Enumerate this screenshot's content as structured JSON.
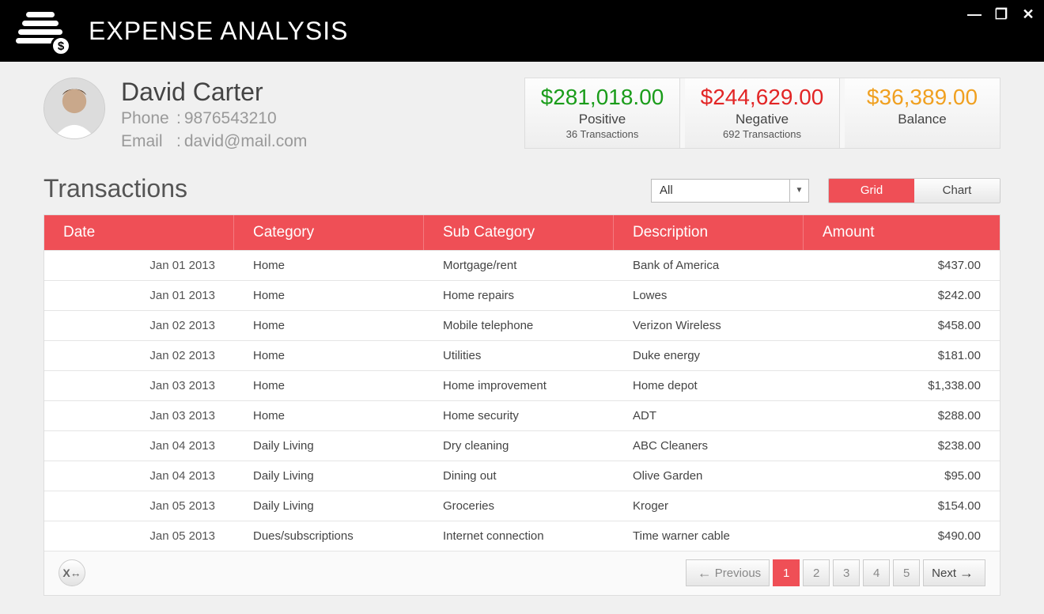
{
  "app": {
    "title": "EXPENSE ANALYSIS"
  },
  "user": {
    "name": "David Carter",
    "phone_label": "Phone",
    "phone": "9876543210",
    "email_label": "Email",
    "email": "david@mail.com"
  },
  "stats": {
    "positive": {
      "value": "$281,018.00",
      "label": "Positive",
      "sub": "36 Transactions"
    },
    "negative": {
      "value": "$244,629.00",
      "label": "Negative",
      "sub": "692 Transactions"
    },
    "balance": {
      "value": "$36,389.00",
      "label": "Balance",
      "sub": ""
    }
  },
  "transactions": {
    "title": "Transactions",
    "filter_selected": "All",
    "view_grid": "Grid",
    "view_chart": "Chart",
    "columns": {
      "date": "Date",
      "category": "Category",
      "subcategory": "Sub Category",
      "description": "Description",
      "amount": "Amount"
    },
    "rows": [
      {
        "date": "Jan 01 2013",
        "category": "Home",
        "subcategory": "Mortgage/rent",
        "description": "Bank of America",
        "amount": "$437.00"
      },
      {
        "date": "Jan 01 2013",
        "category": "Home",
        "subcategory": "Home repairs",
        "description": "Lowes",
        "amount": "$242.00"
      },
      {
        "date": "Jan 02 2013",
        "category": "Home",
        "subcategory": "Mobile telephone",
        "description": "Verizon Wireless",
        "amount": "$458.00"
      },
      {
        "date": "Jan 02 2013",
        "category": "Home",
        "subcategory": "Utilities",
        "description": "Duke energy",
        "amount": "$181.00"
      },
      {
        "date": "Jan 03 2013",
        "category": "Home",
        "subcategory": "Home improvement",
        "description": "Home depot",
        "amount": "$1,338.00"
      },
      {
        "date": "Jan 03 2013",
        "category": "Home",
        "subcategory": "Home security",
        "description": "ADT",
        "amount": "$288.00"
      },
      {
        "date": "Jan 04 2013",
        "category": "Daily Living",
        "subcategory": "Dry cleaning",
        "description": "ABC Cleaners",
        "amount": "$238.00"
      },
      {
        "date": "Jan 04 2013",
        "category": "Daily Living",
        "subcategory": "Dining out",
        "description": "Olive Garden",
        "amount": "$95.00"
      },
      {
        "date": "Jan 05 2013",
        "category": "Daily Living",
        "subcategory": "Groceries",
        "description": "Kroger",
        "amount": "$154.00"
      },
      {
        "date": "Jan 05 2013",
        "category": "Dues/subscriptions",
        "subcategory": "Internet connection",
        "description": "Time warner cable",
        "amount": "$490.00"
      }
    ],
    "pager": {
      "prev": "Previous",
      "next": "Next",
      "pages": [
        "1",
        "2",
        "3",
        "4",
        "5"
      ],
      "active": "1"
    }
  }
}
